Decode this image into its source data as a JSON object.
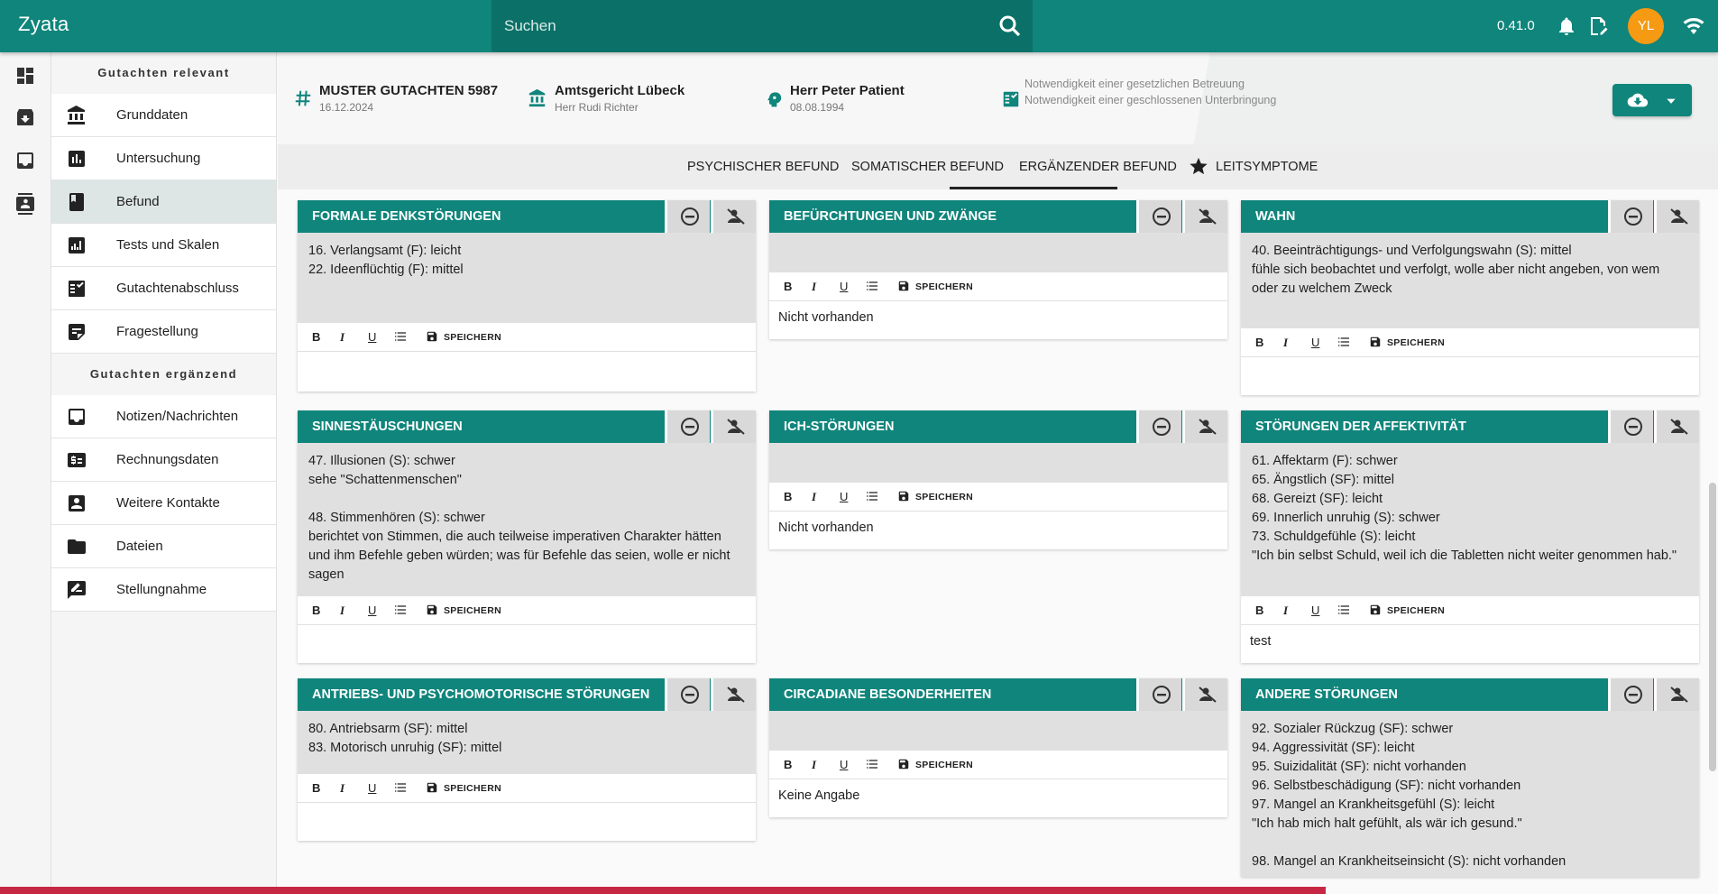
{
  "app": {
    "title": "Zyata",
    "version": "0.41.0",
    "user_initials": "YL"
  },
  "search": {
    "placeholder": "Suchen"
  },
  "sidebar": {
    "section1": "Gutachten relevant",
    "items1": [
      {
        "label": "Grunddaten",
        "icon": "bank-icon"
      },
      {
        "label": "Untersuchung",
        "icon": "bar-chart-icon"
      },
      {
        "label": "Befund",
        "icon": "book-icon"
      },
      {
        "label": "Tests und Skalen",
        "icon": "poll-icon"
      },
      {
        "label": "Gutachtenabschluss",
        "icon": "checklist-icon"
      },
      {
        "label": "Fragestellung",
        "icon": "note-icon"
      }
    ],
    "section2": "Gutachten ergänzend",
    "items2": [
      {
        "label": "Notizen/Nachrichten",
        "icon": "inbox-icon"
      },
      {
        "label": "Rechnungsdaten",
        "icon": "dollar-icon"
      },
      {
        "label": "Weitere Kontakte",
        "icon": "contact-icon"
      },
      {
        "label": "Dateien",
        "icon": "folder-icon"
      },
      {
        "label": "Stellungnahme",
        "icon": "rate-review-icon"
      }
    ]
  },
  "header": {
    "case_title": "MUSTER GUTACHTEN 5987",
    "case_date": "16.12.2024",
    "court_title": "Amtsgericht Lübeck",
    "court_sub": "Herr Rudi Richter",
    "patient_title": "Herr Peter Patient",
    "patient_sub": "08.08.1994",
    "check1": "Notwendigkeit einer gesetzlichen Betreuung",
    "check2": "Notwendigkeit einer geschlossenen Unterbringung"
  },
  "tabs": [
    "PSYCHISCHER BEFUND",
    "SOMATISCHER BEFUND",
    "ERGÄNZENDER BEFUND",
    "LEITSYMPTOME"
  ],
  "toolbar": {
    "bold": "B",
    "italic": "I",
    "underline": "U",
    "save": "SPEICHERN"
  },
  "cards": [
    {
      "title": "FORMALE DENKSTÖRUNGEN",
      "body": "16. Verlangsamt (F): leicht\n22. Ideenflüchtig (F): mittel",
      "editor": ""
    },
    {
      "title": "BEFÜRCHTUNGEN UND ZWÄNGE",
      "body": "",
      "editor": "Nicht vorhanden"
    },
    {
      "title": "WAHN",
      "body": "40. Beeinträchtigungs- und Verfolgungswahn (S): mittel\nfühle sich beobachtet und verfolgt, wolle aber nicht angeben, von wem oder zu welchem Zweck",
      "editor": ""
    },
    {
      "title": "SINNESTÄUSCHUNGEN",
      "body": "47. Illusionen (S): schwer\nsehe \"Schattenmenschen\"\n\n48. Stimmenhören (S): schwer\nberichtet von Stimmen, die auch teilweise imperativen Charakter hätten und ihm Befehle geben würden; was für Befehle das seien, wolle er nicht sagen",
      "editor": ""
    },
    {
      "title": "ICH-STÖRUNGEN",
      "body": "",
      "editor": "Nicht vorhanden"
    },
    {
      "title": "STÖRUNGEN DER AFFEKTIVITÄT",
      "body": "61. Affektarm (F): schwer\n65. Ängstlich (SF): mittel\n68. Gereizt (SF): leicht\n69. Innerlich unruhig (S): schwer\n73. Schuldgefühle (S): leicht\n\"Ich bin selbst Schuld, weil ich die Tabletten nicht weiter genommen hab.\"",
      "editor": "test"
    },
    {
      "title": "ANTRIEBS- UND PSYCHOMOTORISCHE STÖRUNGEN",
      "body": "80. Antriebsarm (SF): mittel\n83. Motorisch unruhig (SF): mittel",
      "editor": ""
    },
    {
      "title": "CIRCADIANE BESONDERHEITEN",
      "body": "",
      "editor": "Keine Angabe"
    },
    {
      "title": "ANDERE STÖRUNGEN",
      "body": "92. Sozialer Rückzug (SF): schwer\n94. Aggressivität (SF): leicht\n95. Suizidalität (SF): nicht vorhanden\n96. Selbstbeschädigung (SF): nicht vorhanden\n97. Mangel an Krankheitsgefühl (S): leicht\n\"Ich hab mich halt gefühlt, als wär ich gesund.\"\n\n98. Mangel an Krankheitseinsicht (S): nicht vorhanden",
      "editor": ""
    }
  ]
}
